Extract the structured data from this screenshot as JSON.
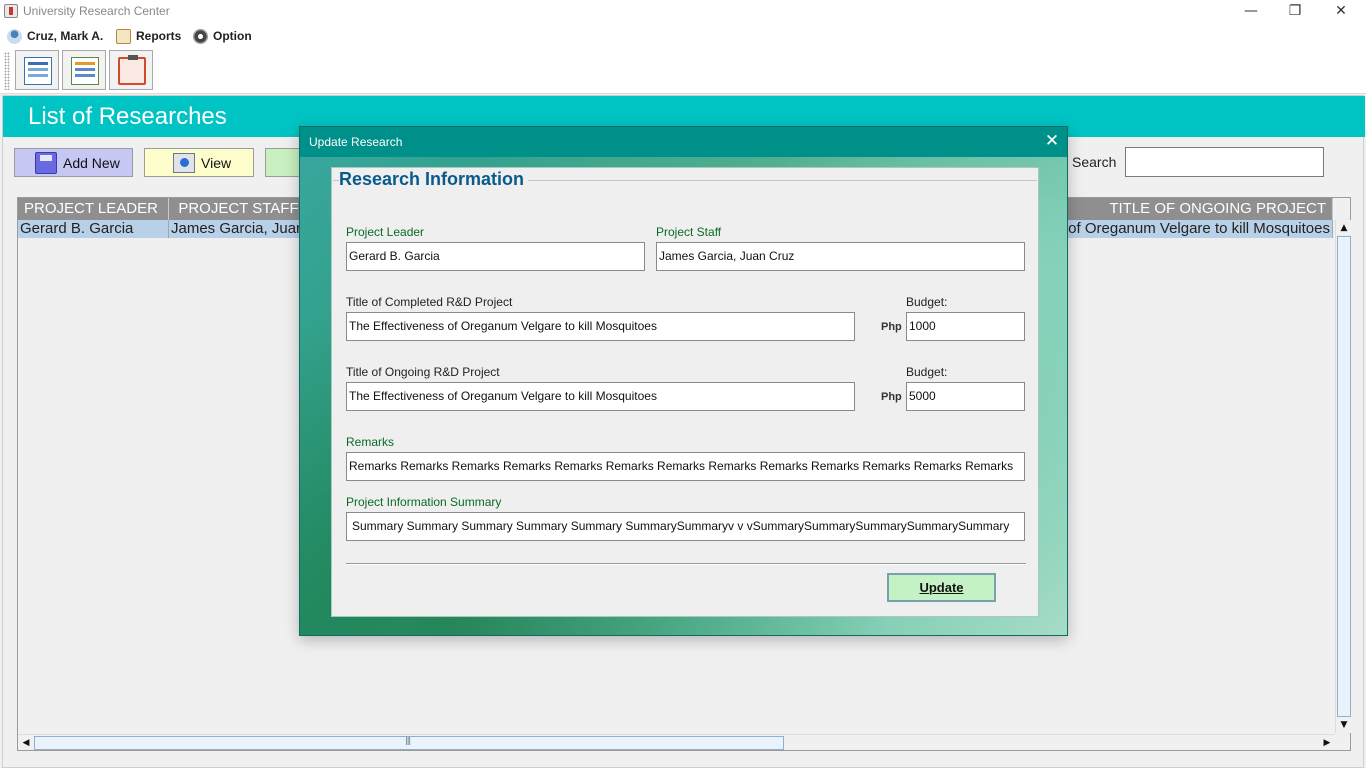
{
  "window": {
    "title": "University Research Center",
    "minimize": "—",
    "restore": "❐",
    "close": "✕"
  },
  "menu": {
    "user": "Cruz, Mark A.",
    "reports": "Reports",
    "option": "Option"
  },
  "page": {
    "title": "List of Researches",
    "add_new": "Add New",
    "view": "View",
    "search_label": "Search",
    "search_value": ""
  },
  "table": {
    "headers": [
      "PROJECT LEADER",
      "PROJECT STAFF",
      "TITLE OF ONGOING PROJECT"
    ],
    "rows": [
      {
        "leader": "Gerard B. Garcia",
        "staff": "James Garcia, Juan Cruz",
        "ongoing": "The Effectiveness of Oreganum Velgare to kill Mosquitoes"
      }
    ]
  },
  "dialog": {
    "title": "Update Research",
    "close": "✕",
    "section": "Research Information",
    "labels": {
      "leader": "Project Leader",
      "staff": "Project Staff",
      "completed": "Title of Completed R&D Project",
      "budget1": "Budget:",
      "ongoing": "Title of Ongoing R&D Project",
      "budget2": "Budget:",
      "remarks": "Remarks",
      "summary": "Project Information Summary",
      "php1": "Php",
      "php2": "Php"
    },
    "values": {
      "leader": "Gerard B. Garcia",
      "staff": "James Garcia, Juan Cruz",
      "completed": "The Effectiveness of Oreganum Velgare to kill Mosquitoes",
      "budget1": "1000",
      "ongoing": "The Effectiveness of Oreganum Velgare to kill Mosquitoes",
      "budget2": "5000",
      "remarks": "Remarks Remarks Remarks Remarks Remarks Remarks Remarks Remarks Remarks Remarks Remarks Remarks Remarks",
      "summary": "Summary Summary Summary Summary Summary SummarySummaryv v vSummarySummarySummarySummarySummary"
    },
    "update_button": "Update"
  },
  "colors": {
    "banner": "#00c4c4",
    "dialog_title": "#00908a",
    "section_title": "#0a5a8c",
    "field_label": "#0a6a24"
  }
}
